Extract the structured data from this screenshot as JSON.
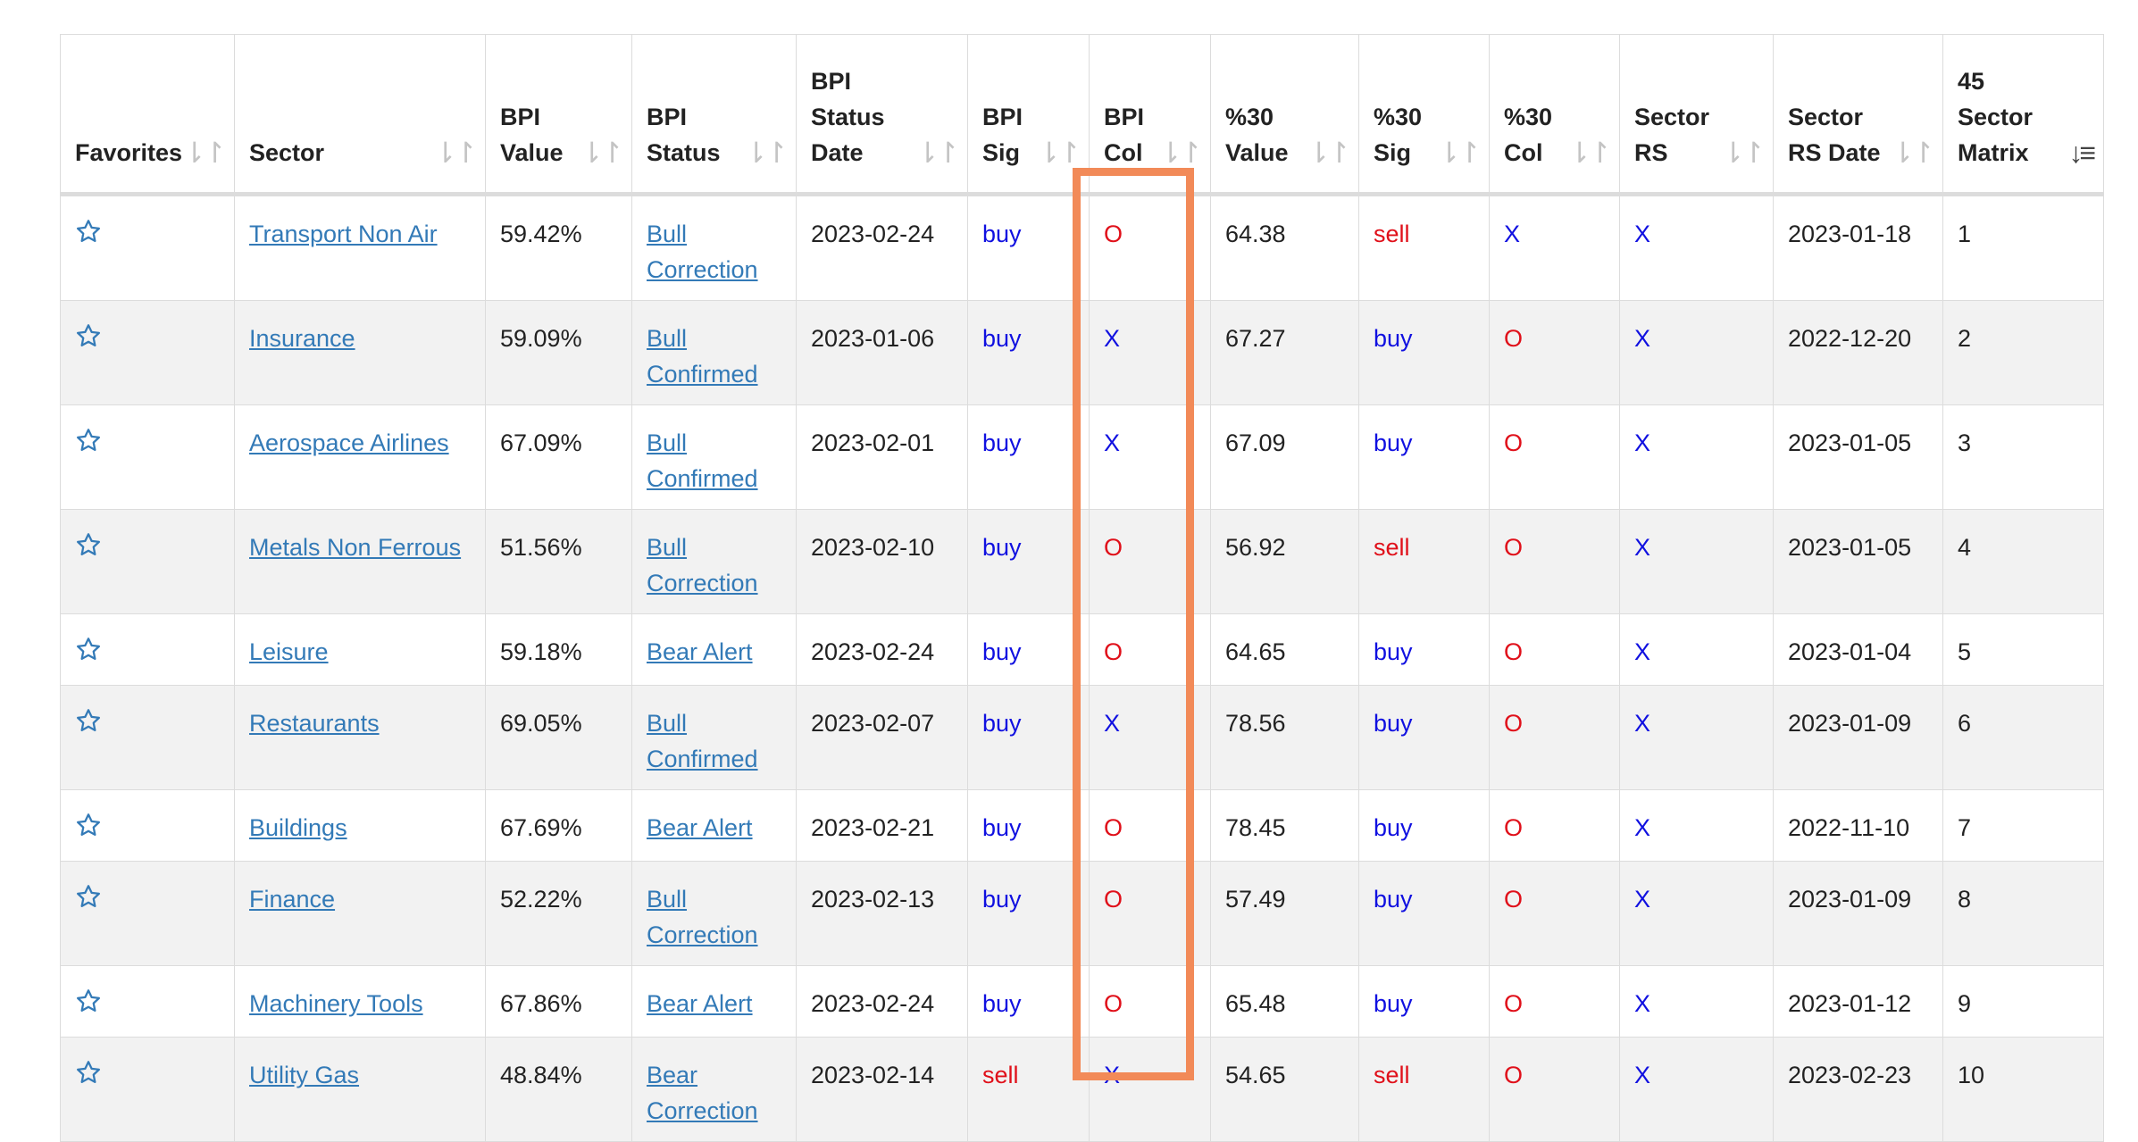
{
  "table": {
    "columns": [
      {
        "label": "Favorites",
        "sort": "⇂↾"
      },
      {
        "label": "Sector",
        "sort": "⇂↾"
      },
      {
        "label": "BPI Value",
        "sort": "⇂↾"
      },
      {
        "label": "BPI Status",
        "sort": "⇂↾"
      },
      {
        "label": "BPI Status Date",
        "sort": "⇂↾"
      },
      {
        "label": "BPI Sig",
        "sort": "⇂↾"
      },
      {
        "label": "BPI Col",
        "sort": "⇂↾"
      },
      {
        "label": "%30 Value",
        "sort": "⇂↾"
      },
      {
        "label": "%30 Sig",
        "sort": "⇂↾"
      },
      {
        "label": "%30 Col",
        "sort": "⇂↾"
      },
      {
        "label": "Sector RS",
        "sort": "⇂↾"
      },
      {
        "label": "Sector RS Date",
        "sort": "⇂↾"
      },
      {
        "label": "45 Sector Matrix",
        "sort": "↓≡"
      }
    ],
    "rows": [
      {
        "sector": "Transport Non Air",
        "bpi_value": "59.42%",
        "bpi_status": "Bull Correction",
        "bpi_status_date": "2023-02-24",
        "bpi_sig": "buy",
        "bpi_col": "O",
        "p30_value": "64.38",
        "p30_sig": "sell",
        "p30_col": "X",
        "sector_rs": "X",
        "sector_rs_date": "2023-01-18",
        "matrix": "1"
      },
      {
        "sector": "Insurance",
        "bpi_value": "59.09%",
        "bpi_status": "Bull Confirmed",
        "bpi_status_date": "2023-01-06",
        "bpi_sig": "buy",
        "bpi_col": "X",
        "p30_value": "67.27",
        "p30_sig": "buy",
        "p30_col": "O",
        "sector_rs": "X",
        "sector_rs_date": "2022-12-20",
        "matrix": "2"
      },
      {
        "sector": "Aerospace Airlines",
        "bpi_value": "67.09%",
        "bpi_status": "Bull Confirmed",
        "bpi_status_date": "2023-02-01",
        "bpi_sig": "buy",
        "bpi_col": "X",
        "p30_value": "67.09",
        "p30_sig": "buy",
        "p30_col": "O",
        "sector_rs": "X",
        "sector_rs_date": "2023-01-05",
        "matrix": "3"
      },
      {
        "sector": "Metals Non Ferrous",
        "bpi_value": "51.56%",
        "bpi_status": "Bull Correction",
        "bpi_status_date": "2023-02-10",
        "bpi_sig": "buy",
        "bpi_col": "O",
        "p30_value": "56.92",
        "p30_sig": "sell",
        "p30_col": "O",
        "sector_rs": "X",
        "sector_rs_date": "2023-01-05",
        "matrix": "4"
      },
      {
        "sector": "Leisure",
        "bpi_value": "59.18%",
        "bpi_status": "Bear Alert",
        "bpi_status_date": "2023-02-24",
        "bpi_sig": "buy",
        "bpi_col": "O",
        "p30_value": "64.65",
        "p30_sig": "buy",
        "p30_col": "O",
        "sector_rs": "X",
        "sector_rs_date": "2023-01-04",
        "matrix": "5"
      },
      {
        "sector": "Restaurants",
        "bpi_value": "69.05%",
        "bpi_status": "Bull Confirmed",
        "bpi_status_date": "2023-02-07",
        "bpi_sig": "buy",
        "bpi_col": "X",
        "p30_value": "78.56",
        "p30_sig": "buy",
        "p30_col": "O",
        "sector_rs": "X",
        "sector_rs_date": "2023-01-09",
        "matrix": "6"
      },
      {
        "sector": "Buildings",
        "bpi_value": "67.69%",
        "bpi_status": "Bear Alert",
        "bpi_status_date": "2023-02-21",
        "bpi_sig": "buy",
        "bpi_col": "O",
        "p30_value": "78.45",
        "p30_sig": "buy",
        "p30_col": "O",
        "sector_rs": "X",
        "sector_rs_date": "2022-11-10",
        "matrix": "7"
      },
      {
        "sector": "Finance",
        "bpi_value": "52.22%",
        "bpi_status": "Bull Correction",
        "bpi_status_date": "2023-02-13",
        "bpi_sig": "buy",
        "bpi_col": "O",
        "p30_value": "57.49",
        "p30_sig": "buy",
        "p30_col": "O",
        "sector_rs": "X",
        "sector_rs_date": "2023-01-09",
        "matrix": "8"
      },
      {
        "sector": "Machinery Tools",
        "bpi_value": "67.86%",
        "bpi_status": "Bear Alert",
        "bpi_status_date": "2023-02-24",
        "bpi_sig": "buy",
        "bpi_col": "O",
        "p30_value": "65.48",
        "p30_sig": "buy",
        "p30_col": "O",
        "sector_rs": "X",
        "sector_rs_date": "2023-01-12",
        "matrix": "9"
      },
      {
        "sector": "Utility Gas",
        "bpi_value": "48.84%",
        "bpi_status": "Bear Correction",
        "bpi_status_date": "2023-02-14",
        "bpi_sig": "sell",
        "bpi_col": "X",
        "p30_value": "54.65",
        "p30_sig": "sell",
        "p30_col": "O",
        "sector_rs": "X",
        "sector_rs_date": "2023-02-23",
        "matrix": "10"
      }
    ]
  },
  "colors": {
    "link": "#337ab7",
    "buy": "#1010e0",
    "sell": "#e0101a",
    "highlight": "#f28a58",
    "row_stripe": "#f2f2f2"
  },
  "icons": {
    "favorite": "star-outline-icon",
    "sort": "sort-arrows-icon",
    "sort_active": "sort-amount-down-icon"
  }
}
